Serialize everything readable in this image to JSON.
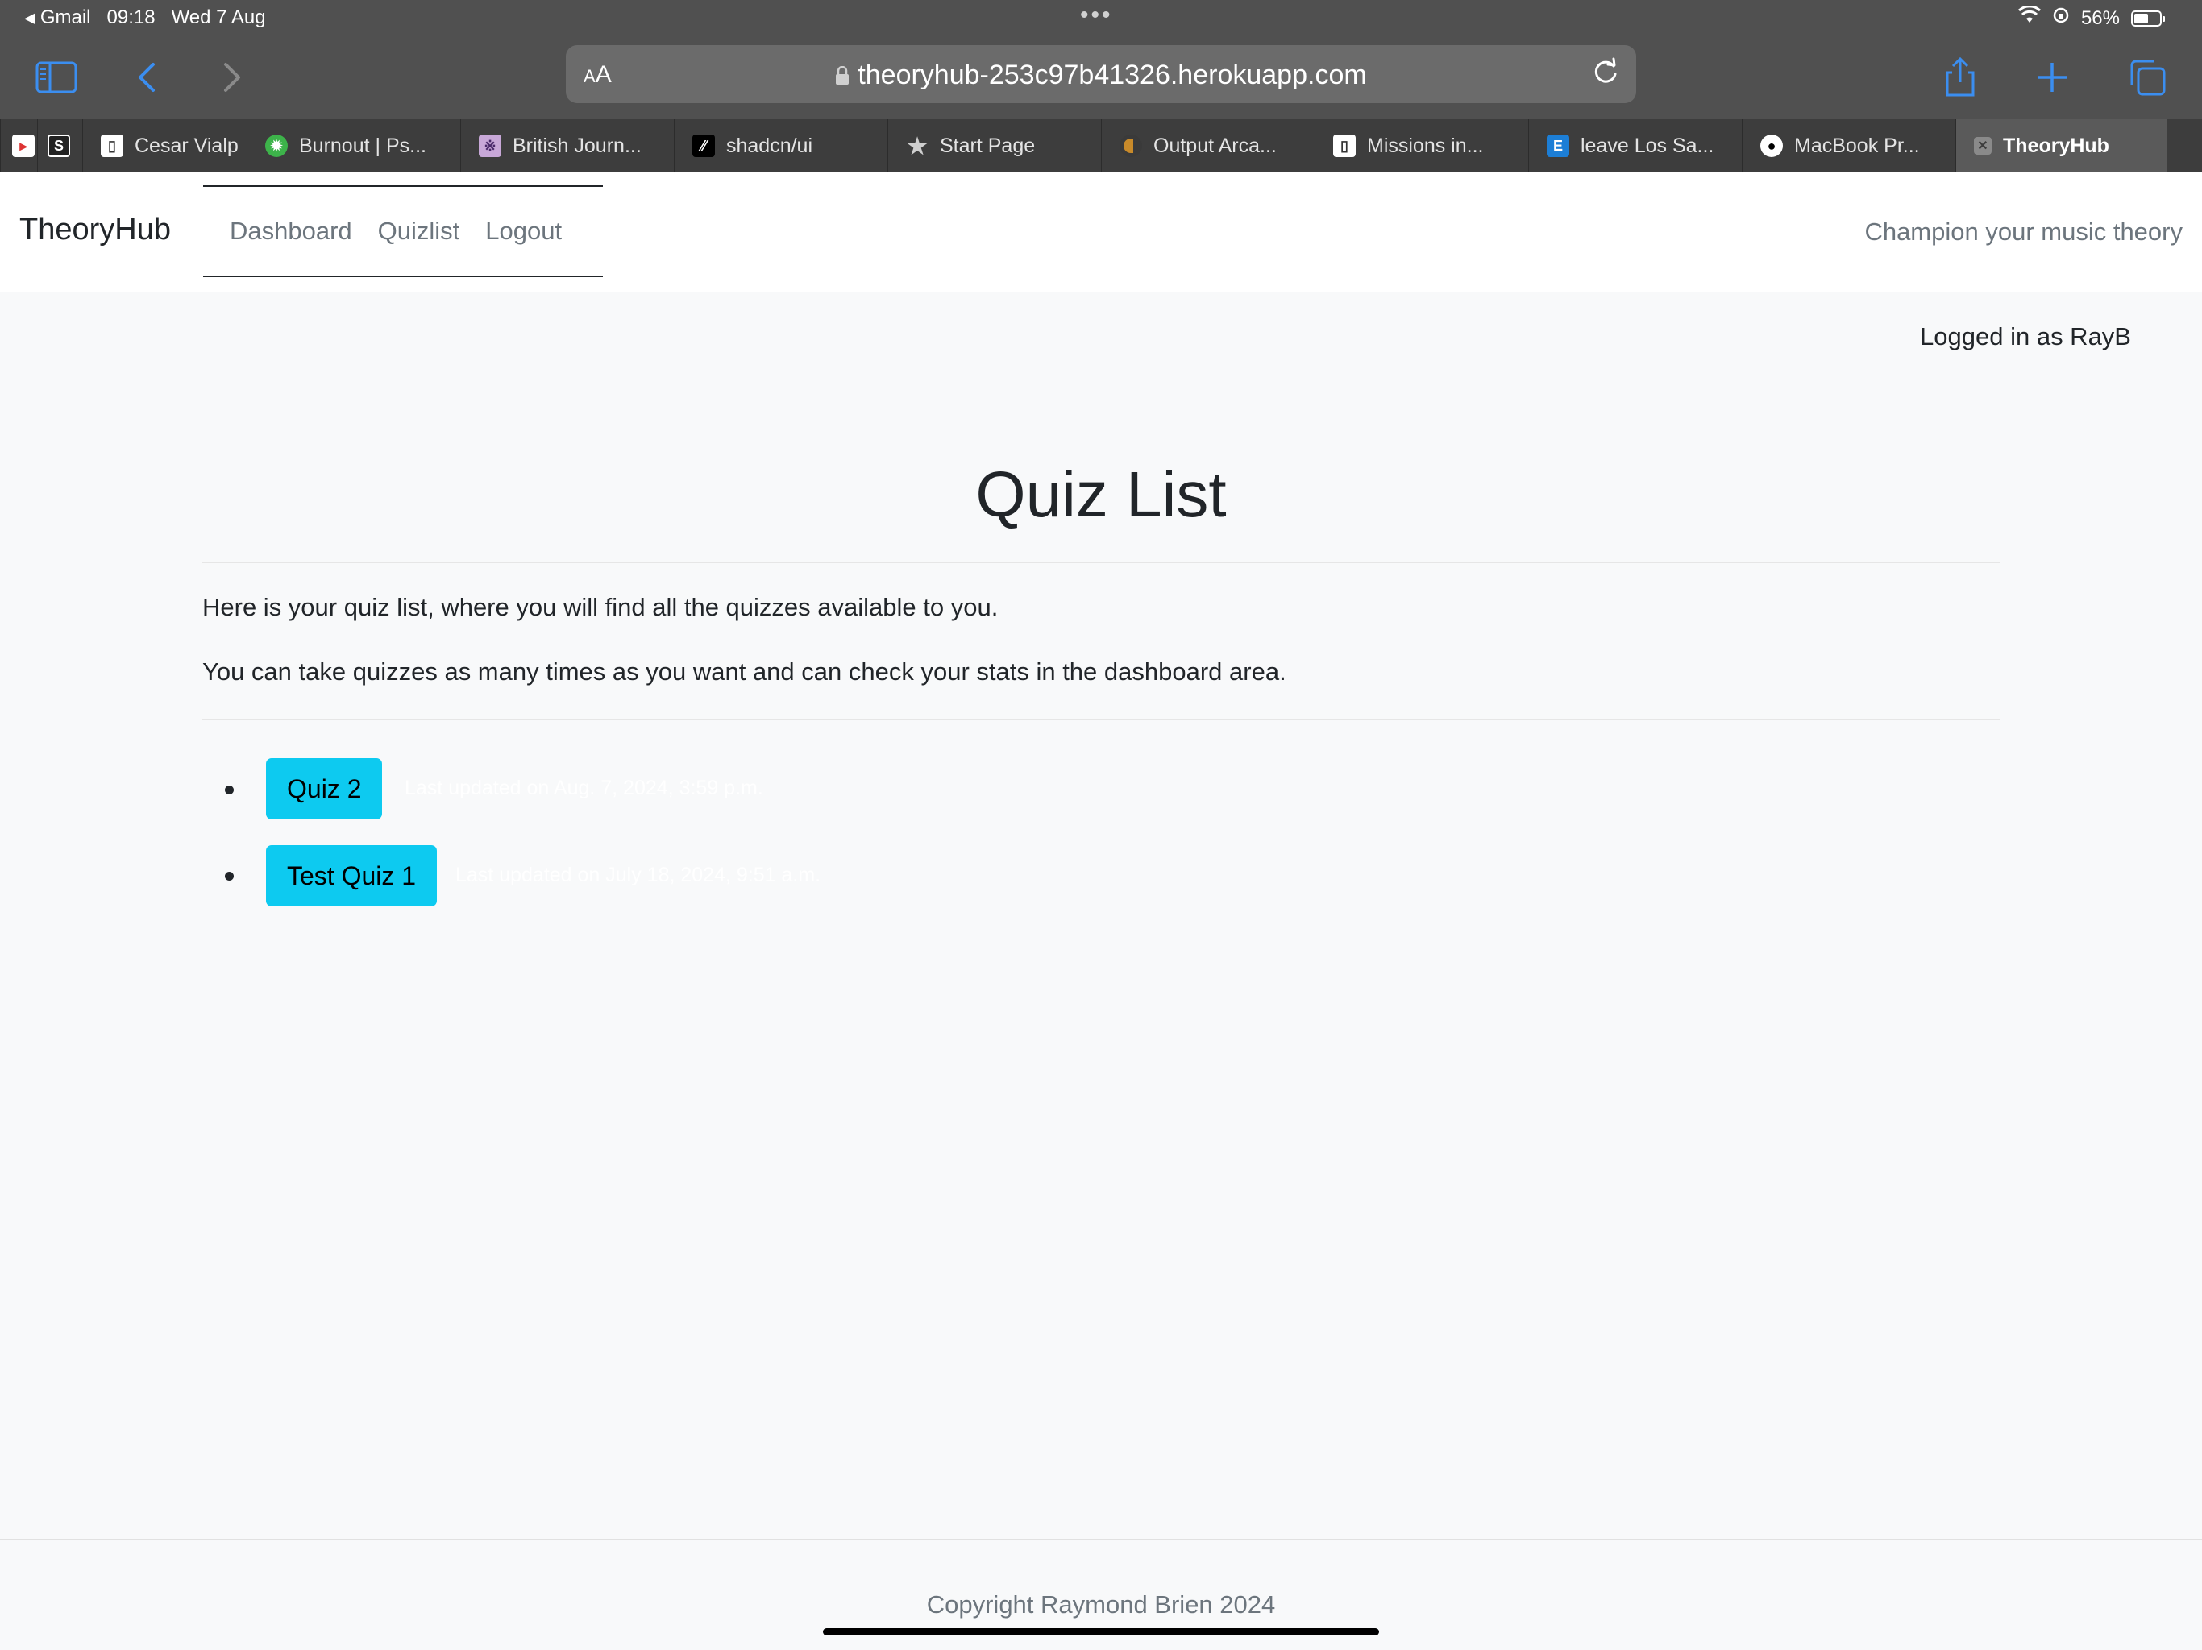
{
  "status_bar": {
    "back_app": "Gmail",
    "time": "09:18",
    "date": "Wed 7 Aug",
    "battery": "56%",
    "battery_level": 0.56
  },
  "browser": {
    "aa_label": "AA",
    "url": "theoryhub-253c97b41326.herokuapp.com",
    "tabs": [
      {
        "title": "",
        "icon": "red-favicon"
      },
      {
        "title": "",
        "icon": "s-favicon"
      },
      {
        "title": "Cesar Vialp",
        "icon": "document-favicon"
      },
      {
        "title": "Burnout | Ps...",
        "icon": "gear-favicon"
      },
      {
        "title": "British Journ...",
        "icon": "journal-favicon"
      },
      {
        "title": "shadcn/ui",
        "icon": "shadcn-favicon"
      },
      {
        "title": "Start Page",
        "icon": "star-icon"
      },
      {
        "title": "Output Arca...",
        "icon": "circle-favicon"
      },
      {
        "title": "Missions in...",
        "icon": "document-favicon"
      },
      {
        "title": "leave Los Sa...",
        "icon": "e-favicon"
      },
      {
        "title": "MacBook Pr...",
        "icon": "apple-favicon"
      },
      {
        "title": "TheoryHub",
        "icon": "close-icon"
      }
    ]
  },
  "site": {
    "brand": "TheoryHub",
    "nav": [
      "Dashboard",
      "Quizlist",
      "Logout"
    ],
    "tagline": "Champion your music theory",
    "logged_in": "Logged in as RayB",
    "title": "Quiz List",
    "intro_1": "Here is your quiz list, where you will find all the quizzes available to you.",
    "intro_2": "You can take quizzes as many times as you want and can check your stats in the dashboard area.",
    "quizzes": [
      {
        "name": "Quiz 2",
        "updated": "Last updated on Aug. 7, 2024, 3:59 p.m."
      },
      {
        "name": "Test Quiz 1",
        "updated": "Last updated on July 18, 2024, 9:51 a.m."
      }
    ],
    "footer": "Copyright Raymond Brien 2024"
  },
  "colors": {
    "quiz_button": "#0dcaf0",
    "page_bg": "#f8f9fa",
    "browser_chrome": "#505050",
    "accent_blue": "#3b8ef0"
  }
}
